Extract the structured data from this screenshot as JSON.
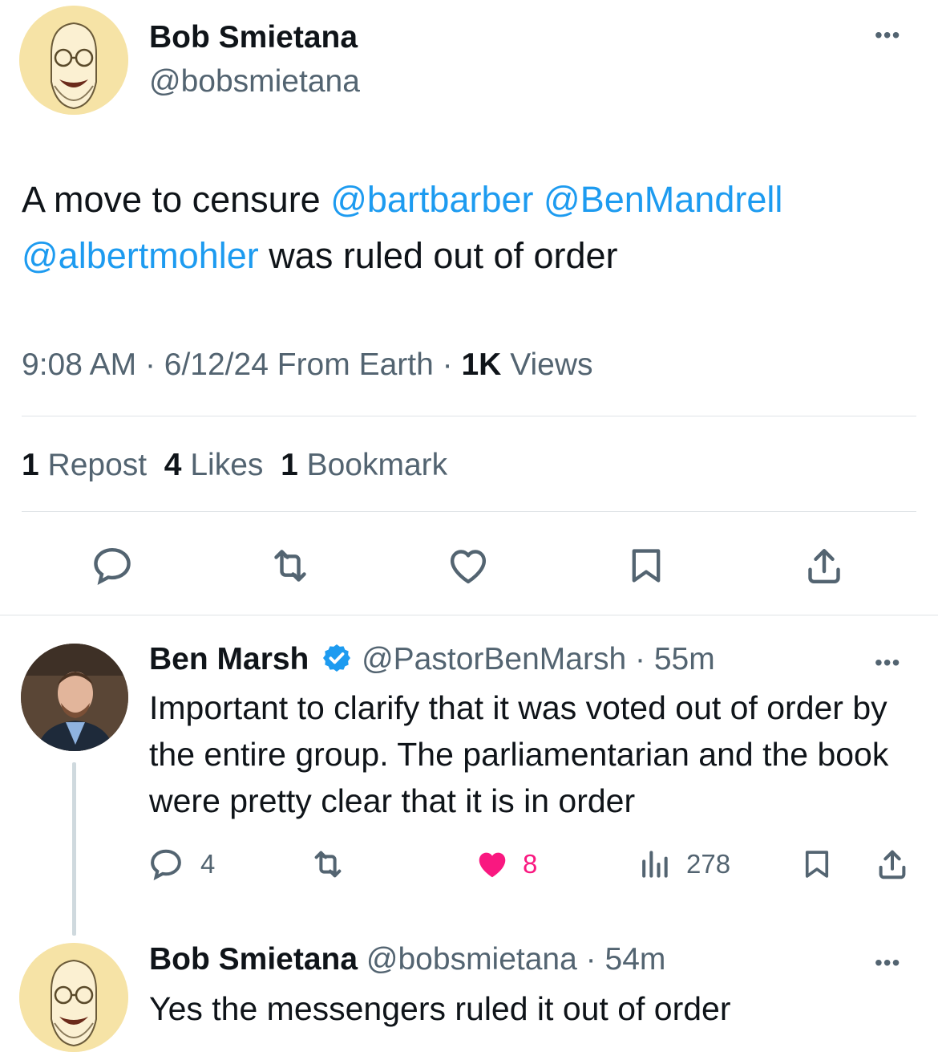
{
  "main_tweet": {
    "author_name": "Bob Smietana",
    "author_handle": "@bobsmietana",
    "text_prefix": "A move to censure ",
    "mention_1": "@bartbarber",
    "mention_2": "@BenMandrell",
    "mention_3": "@albertmohler",
    "text_suffix": " was ruled out of order",
    "time": "9:08 AM",
    "date": "6/12/24",
    "source": "From Earth",
    "views_count": "1K",
    "views_label": "Views",
    "reposts_count": "1",
    "reposts_label": "Repost",
    "likes_count": "4",
    "likes_label": "Likes",
    "bookmarks_count": "1",
    "bookmarks_label": "Bookmark",
    "dot": "·"
  },
  "reply_1": {
    "author_name": "Ben Marsh",
    "author_handle": "@PastorBenMarsh",
    "time_ago": "55m",
    "text": "Important to clarify that it was voted out of order by the entire group. The parliamentarian and the book were pretty clear that it is in order",
    "replies": "4",
    "likes": "8",
    "views": "278",
    "verified": true
  },
  "reply_2": {
    "author_name": "Bob Smietana",
    "author_handle": "@bobsmietana",
    "time_ago": "54m",
    "text": "Yes the messengers ruled it out of order"
  },
  "colors": {
    "link": "#1d9bf0",
    "secondary": "#536471",
    "like_active": "#f91880",
    "divider": "#dfe3e6"
  },
  "icons": [
    "reply-icon",
    "repost-icon",
    "like-icon",
    "bookmark-icon",
    "share-icon",
    "views-icon",
    "verified-badge-icon",
    "more-icon"
  ]
}
